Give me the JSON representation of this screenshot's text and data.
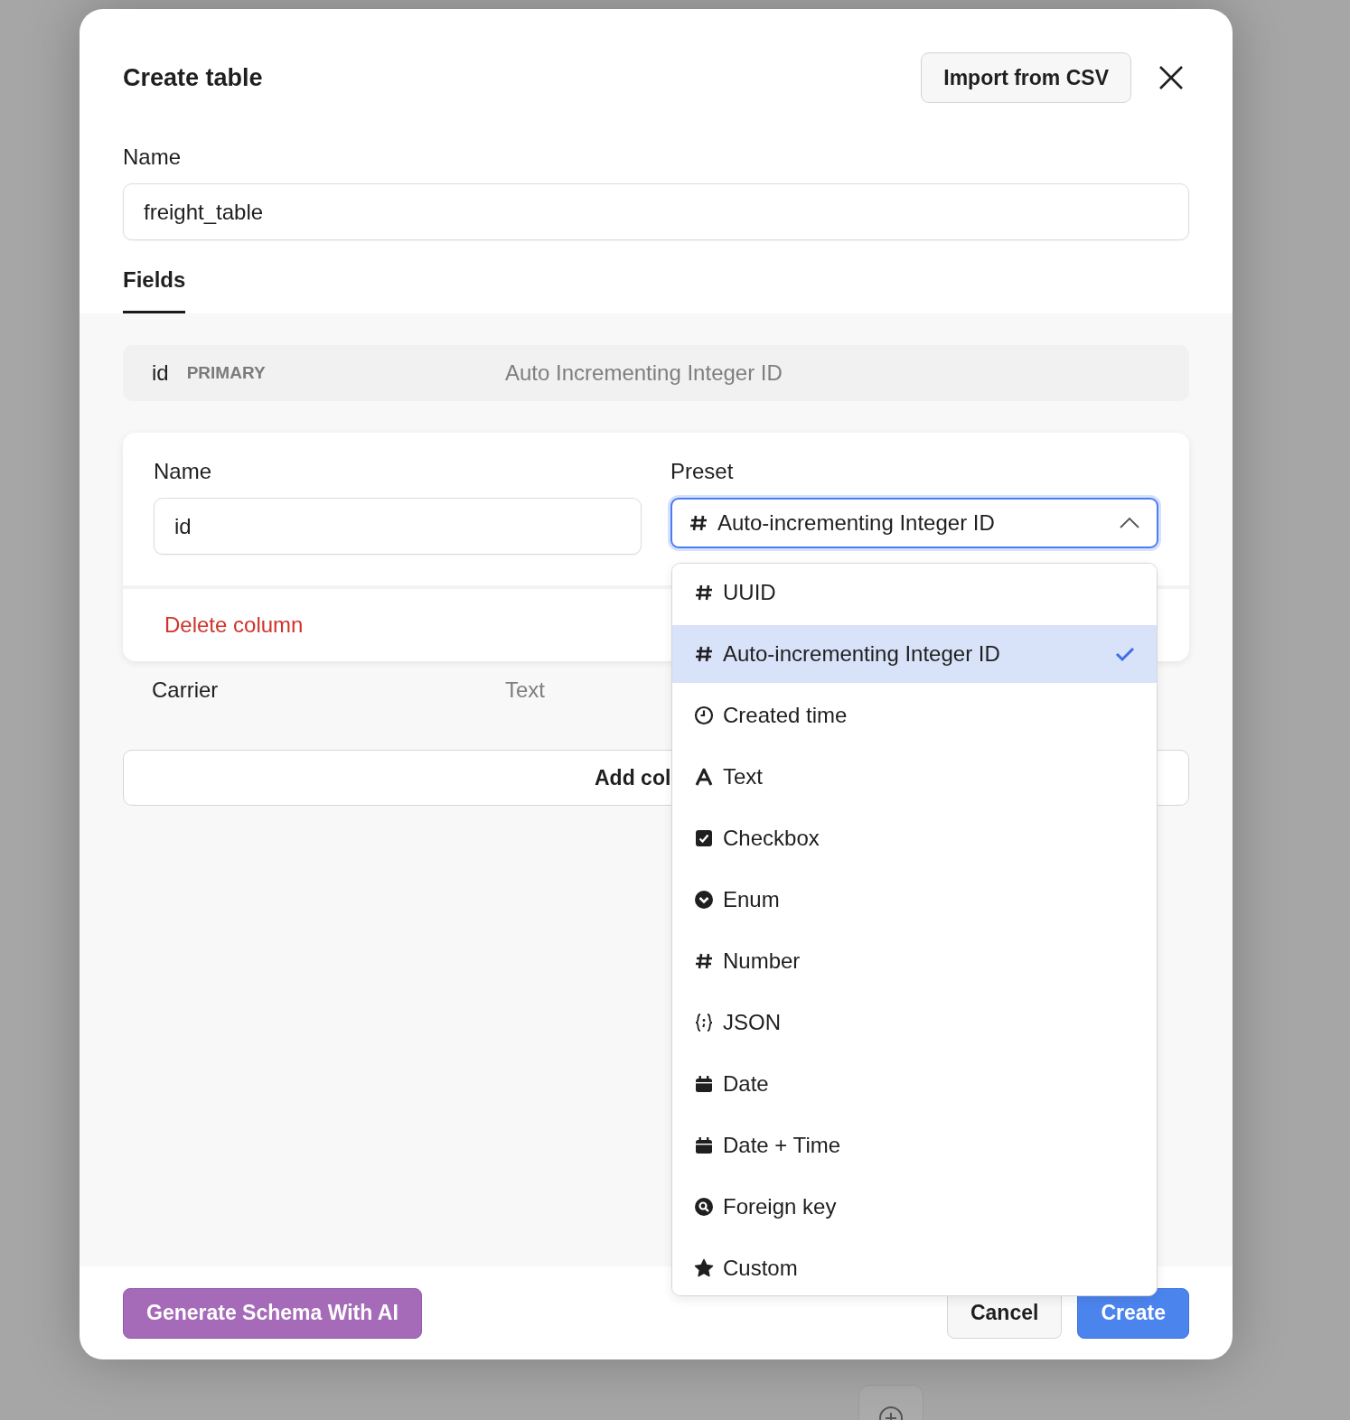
{
  "dialog": {
    "title": "Create table",
    "import_button": "Import from CSV"
  },
  "name_field": {
    "label": "Name",
    "value": "freight_table"
  },
  "tabs": [
    {
      "label": "Fields",
      "selected": true
    }
  ],
  "fields": [
    {
      "kind": "summary",
      "name": "id",
      "badge": "PRIMARY",
      "type": "Auto Incrementing Integer ID"
    },
    {
      "kind": "editor",
      "name_label": "Name",
      "name_value": "id",
      "preset_label": "Preset",
      "preset": {
        "kind": "hash",
        "value": "Auto-incrementing Integer ID",
        "expanded": true
      },
      "delete_label": "Delete column"
    },
    {
      "kind": "summary",
      "name": "Carrier",
      "type": "Text"
    }
  ],
  "add_button": "Add col",
  "preset_options": [
    {
      "kind": "hash",
      "label": "UUID",
      "selected": false
    },
    {
      "kind": "hash",
      "label": "Auto-incrementing Integer ID",
      "selected": true
    },
    {
      "kind": "clock",
      "label": "Created time",
      "selected": false
    },
    {
      "kind": "letter",
      "label": "Text",
      "selected": false
    },
    {
      "kind": "checkbox",
      "label": "Checkbox",
      "selected": false
    },
    {
      "kind": "chevron-circle",
      "label": "Enum",
      "selected": false
    },
    {
      "kind": "hash",
      "label": "Number",
      "selected": false
    },
    {
      "kind": "braces",
      "label": "JSON",
      "selected": false
    },
    {
      "kind": "calendar",
      "label": "Date",
      "selected": false
    },
    {
      "kind": "calendar",
      "label": "Date + Time",
      "selected": false
    },
    {
      "kind": "search-circle",
      "label": "Foreign key",
      "selected": false
    },
    {
      "kind": "star",
      "label": "Custom",
      "selected": false
    }
  ],
  "footer": {
    "ai_button": "Generate Schema With AI",
    "cancel_button": "Cancel",
    "create_button": "Create"
  }
}
